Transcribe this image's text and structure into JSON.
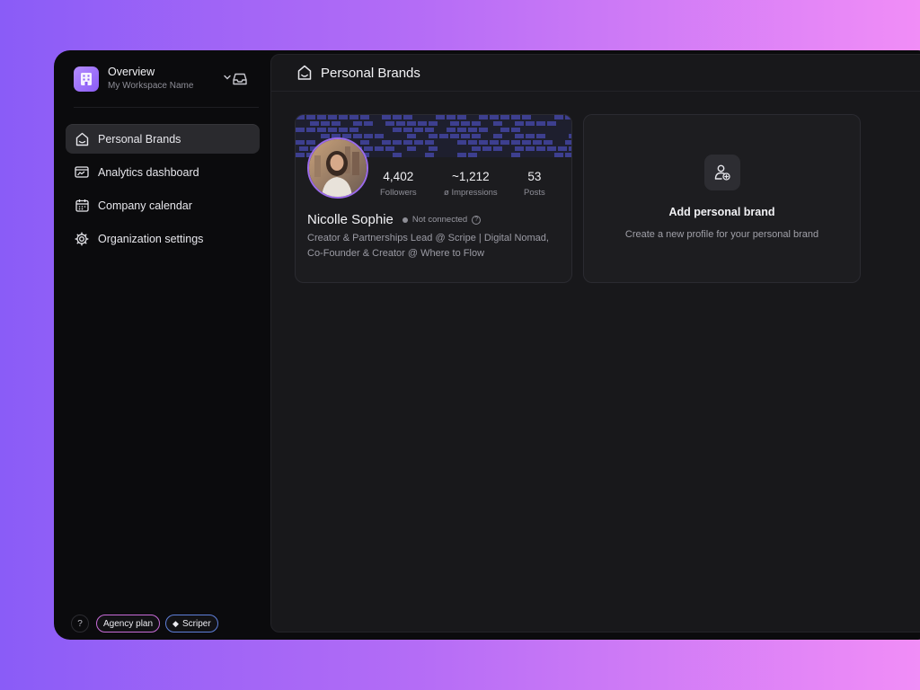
{
  "workspace": {
    "title": "Overview",
    "subtitle": "My Workspace Name"
  },
  "sidebar": {
    "items": [
      {
        "label": "Personal Brands",
        "icon": "home-icon",
        "active": true
      },
      {
        "label": "Analytics dashboard",
        "icon": "analytics-icon",
        "active": false
      },
      {
        "label": "Company calendar",
        "icon": "calendar-icon",
        "active": false
      },
      {
        "label": "Organization settings",
        "icon": "gear-icon",
        "active": false
      }
    ]
  },
  "footer": {
    "help": "?",
    "plan": "Agency plan",
    "brand": "Scriper"
  },
  "header": {
    "title": "Personal Brands"
  },
  "brand_card": {
    "name": "Nicolle Sophie",
    "status": "Not connected",
    "stats": [
      {
        "value": "4,402",
        "label": "Followers"
      },
      {
        "value": "~1,212",
        "label": "ø Impressions"
      },
      {
        "value": "53",
        "label": "Posts"
      }
    ],
    "bio": "Creator & Partnerships Lead @ Scripe | Digital Nomad, Co-Founder & Creator @ Where to Flow"
  },
  "add_card": {
    "title": "Add personal brand",
    "subtitle": "Create a new profile for your personal brand"
  },
  "colors": {
    "accent": "#8b5cf6",
    "banner": "#3d3f8f",
    "window_bg": "#0b0b0d",
    "panel_bg": "#18181b"
  }
}
